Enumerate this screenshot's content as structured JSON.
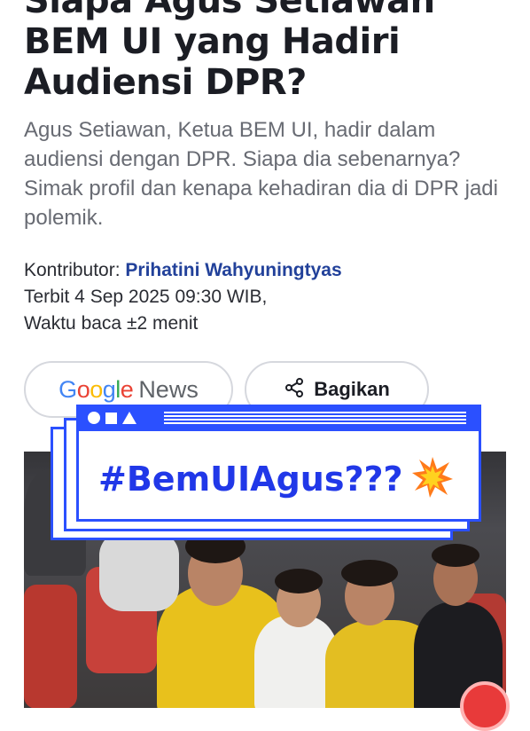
{
  "article": {
    "headline_lines": [
      "Siapa Agus Setiawan",
      "BEM UI yang Hadiri",
      "Audiensi DPR?"
    ],
    "summary": "Agus Setiawan, Ketua BEM UI, hadir dalam audiensi dengan DPR. Siapa dia sebenarnya? Simak profil dan kenapa kehadiran dia di DPR jadi polemik.",
    "contributor_label": "Kontributor:",
    "contributor_name": "Prihatini Wahyuningtyas",
    "published": "Terbit 4 Sep 2025 09:30 WIB,",
    "read_time": "Waktu baca ±2 menit"
  },
  "actions": {
    "google_news": {
      "google": "Google",
      "news": "News"
    },
    "share_label": "Bagikan"
  },
  "overlay": {
    "hashtag": "#BemUIAgus???",
    "accent_color": "#2b50ff"
  },
  "icons": {
    "share": "share-icon",
    "burst": "collision-icon",
    "badge": "notification-badge"
  }
}
